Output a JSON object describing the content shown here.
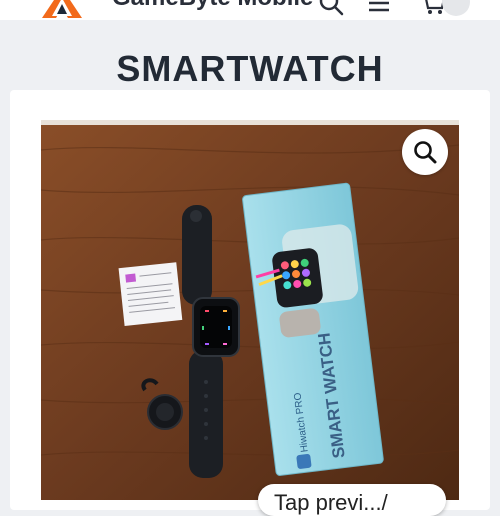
{
  "header": {
    "brand_name": "GameByte Mobile",
    "icons": [
      "logo-icon",
      "search-icon",
      "menu-icon",
      "cart-icon",
      "user-icon"
    ]
  },
  "page": {
    "title": "SMARTWATCH"
  },
  "gallery": {
    "zoom_icon": "magnifier-icon",
    "product_box_brand": "Hiwatch PRO",
    "product_box_label": "SMART WATCH",
    "next_pill_text": "Tap previ.../"
  },
  "colors": {
    "accent_orange": "#f26a1b",
    "title_text": "#222a35",
    "page_background": "#eef0f3",
    "wood": "#6b3a1f",
    "box_teal": "#8fd3e2"
  }
}
